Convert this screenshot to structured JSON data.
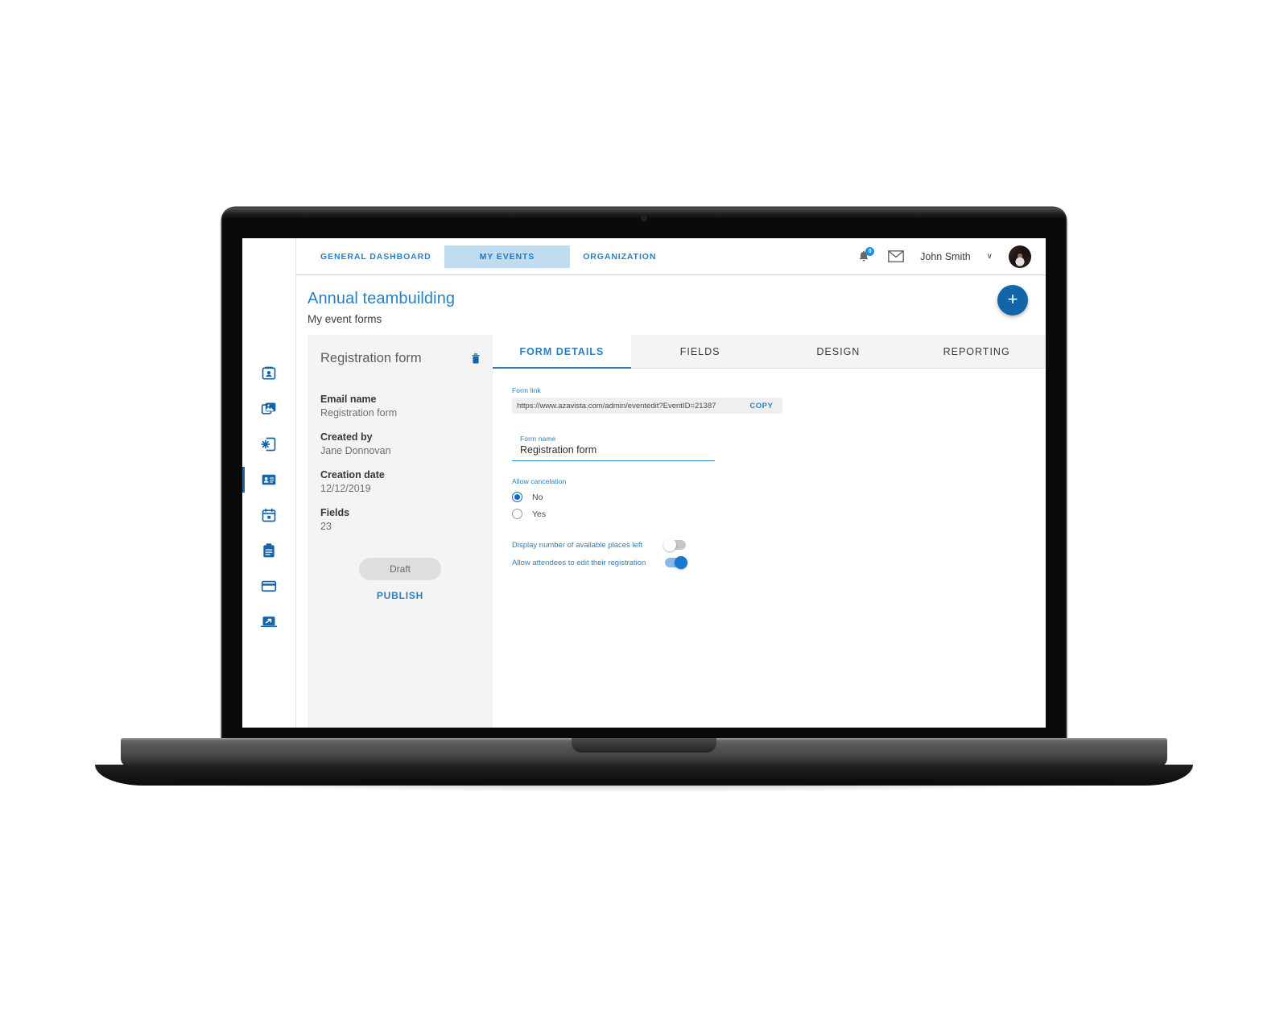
{
  "nav": {
    "tabs": [
      {
        "label": "GENERAL DASHBOARD",
        "selected": false
      },
      {
        "label": "MY EVENTS",
        "selected": true
      },
      {
        "label": "ORGANIZATION",
        "selected": false
      }
    ],
    "notification_count": "0",
    "user_name": "John Smith",
    "chevron": "∨"
  },
  "page": {
    "title": "Annual teambuilding",
    "subtitle": "My event forms",
    "add_button": "+"
  },
  "sidebar": {
    "items": [
      {
        "name": "badge-icon",
        "active": false
      },
      {
        "name": "gallery-icon",
        "active": false
      },
      {
        "name": "page-settings-icon",
        "active": false
      },
      {
        "name": "contact-card-icon",
        "active": true
      },
      {
        "name": "calendar-icon",
        "active": false
      },
      {
        "name": "clipboard-icon",
        "active": false
      },
      {
        "name": "credit-card-icon",
        "active": false
      },
      {
        "name": "share-export-icon",
        "active": false
      }
    ]
  },
  "info_panel": {
    "title": "Registration form",
    "fields": [
      {
        "key": "Email name",
        "value": "Registration form"
      },
      {
        "key": "Created by",
        "value": "Jane Donnovan"
      },
      {
        "key": "Creation date",
        "value": "12/12/2019"
      },
      {
        "key": "Fields",
        "value": "23"
      }
    ],
    "status_label": "Draft",
    "publish_label": "PUBLISH"
  },
  "tabs": [
    {
      "label": "FORM DETAILS",
      "active": true
    },
    {
      "label": "FIELDS",
      "active": false
    },
    {
      "label": "DESIGN",
      "active": false
    },
    {
      "label": "REPORTING",
      "active": false
    }
  ],
  "form": {
    "link_label": "Form link",
    "link_value": "https://www.azavista.com/admin/eventedit?EventID=21387",
    "copy_label": "COPY",
    "name_label": "Form name",
    "name_value": "Registration form",
    "name_placeholder": "Form name",
    "cancelation_label": "Allow cancelation",
    "cancelation_options": [
      {
        "label": "No",
        "selected": true
      },
      {
        "label": "Yes",
        "selected": false
      }
    ],
    "toggles": [
      {
        "label": "Display number of available places left",
        "on": false
      },
      {
        "label": "Allow attendees to edit their registration",
        "on": true
      }
    ]
  },
  "colors": {
    "accent": "#2a7fc4",
    "accent_dark": "#1465a8",
    "tab_selected_bg": "#bfdcf0",
    "panel_bg": "#f4f4f4"
  }
}
